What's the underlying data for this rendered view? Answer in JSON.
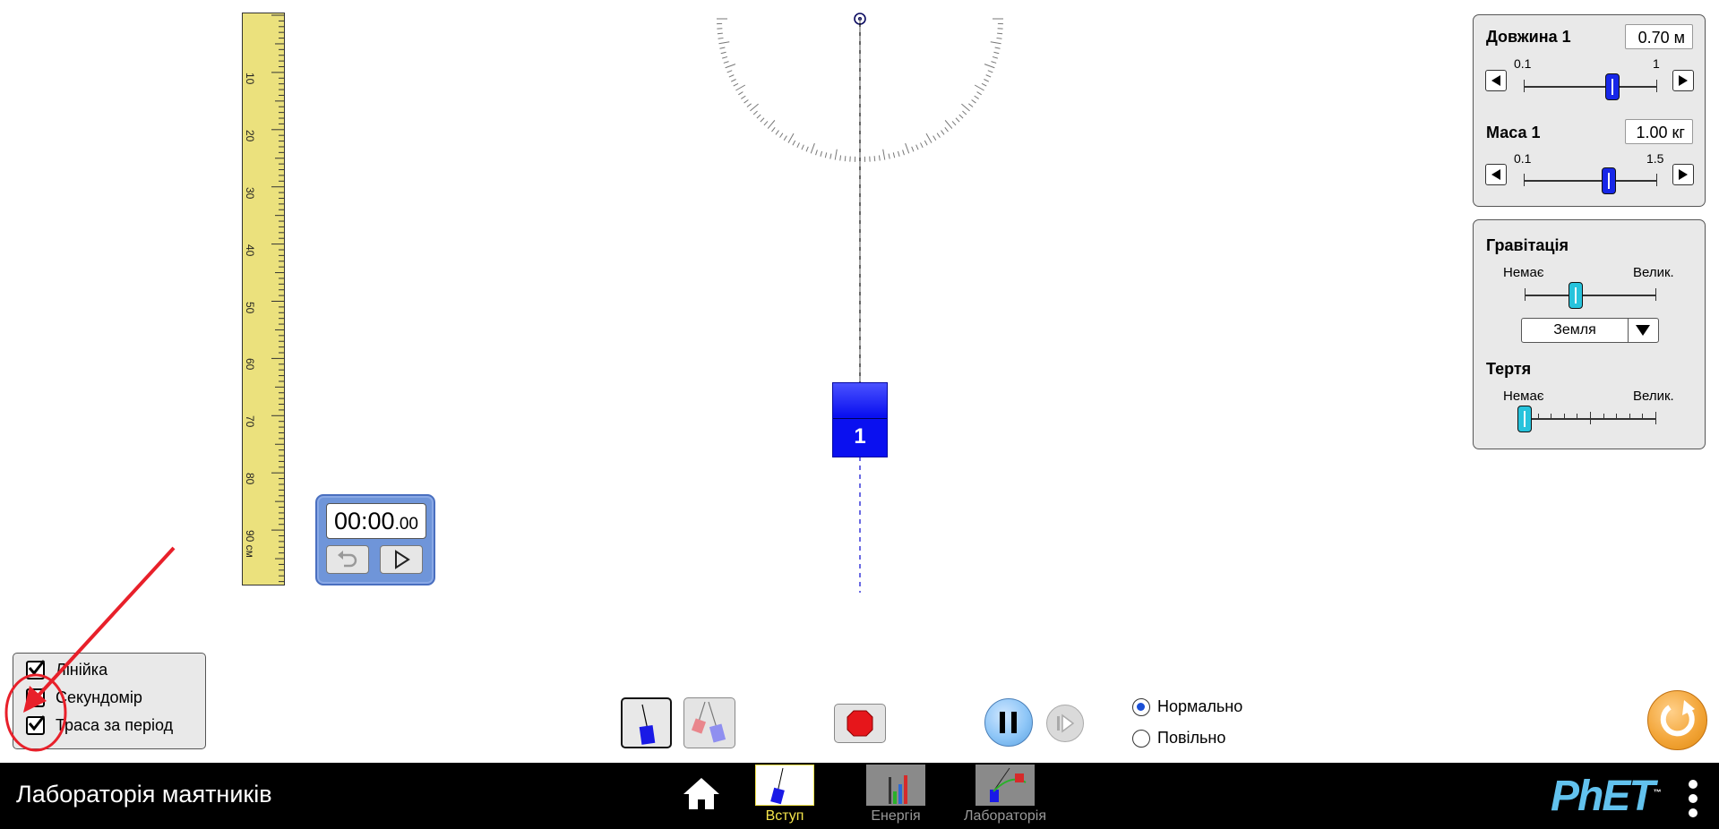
{
  "app": {
    "title": "Лабораторія маятників"
  },
  "ruler": {
    "labels": [
      "10",
      "20",
      "30",
      "40",
      "50",
      "60",
      "70",
      "80",
      "90 см"
    ]
  },
  "stopwatch": {
    "time_main": "00:00",
    "time_fraction": ".00"
  },
  "pendulum": {
    "mass_label": "1"
  },
  "length_control": {
    "label": "Довжина 1",
    "value": "0.70 м",
    "min": "0.1",
    "max": "1",
    "level": 0.67
  },
  "mass_control": {
    "label": "Маса 1",
    "value": "1.00 кг",
    "min": "0.1",
    "max": "1.5",
    "level": 0.64
  },
  "gravity": {
    "label": "Гравітація",
    "min_label": "Немає",
    "max_label": "Велик.",
    "level": 0.39,
    "planet": "Земля"
  },
  "friction": {
    "label": "Тертя",
    "min_label": "Немає",
    "max_label": "Велик.",
    "level": 0.0
  },
  "tools": {
    "items": [
      {
        "label": "Лінійка",
        "checked": true
      },
      {
        "label": "Секундомір",
        "checked": true
      },
      {
        "label": "Траса за період",
        "checked": true
      }
    ]
  },
  "speed": {
    "normal_label": "Нормально",
    "slow_label": "Повільно",
    "selected": "normal"
  },
  "tabs": [
    {
      "label": "Вступ",
      "active": true
    },
    {
      "label": "Енергія",
      "active": false
    },
    {
      "label": "Лабораторія",
      "active": false
    }
  ],
  "brand": {
    "logo": "PhET",
    "tm": "™"
  },
  "colors": {
    "mass_blue": "#0a10f0",
    "slider_cyan": "#27c3dc",
    "active_tab": "#f5e54b",
    "reset_orange": "#f3a63a",
    "annotation_red": "#e8202a"
  }
}
